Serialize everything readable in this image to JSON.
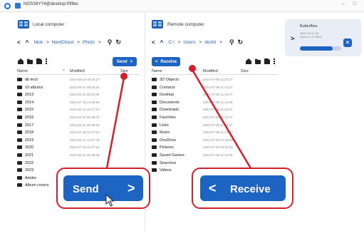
{
  "window": {
    "title": "NGSS8YY4@desktop-f0f8ec",
    "controls": "– □"
  },
  "local": {
    "title": "Local computer",
    "breadcrumb": [
      "Nick",
      "NextCloud",
      "Photo"
    ],
    "send_label": "Send",
    "columns": {
      "name": "Name",
      "modified": "Modified",
      "size": "Size"
    },
    "files": [
      {
        "name": "db tech",
        "date": "2024-05-10 09:26:27"
      },
      {
        "name": "10 albums",
        "date": "2024-05-11 09:25:40"
      },
      {
        "name": "2013",
        "date": "2024-05-11 09:22:36"
      },
      {
        "name": "2014",
        "date": "2024-07-16 14:59:58"
      },
      {
        "name": "2015",
        "date": "2024-05-11 10:27:10"
      },
      {
        "name": "2016",
        "date": "2024-05-11 09:38:03"
      },
      {
        "name": "2017",
        "date": "2024-05-11 09:38:25"
      },
      {
        "name": "2018",
        "date": "2024-07-16 14:47:22"
      },
      {
        "name": "2019",
        "date": "2024-05-11 12:07:44"
      },
      {
        "name": "2020",
        "date": "2024-07-16 14:57:22"
      },
      {
        "name": "2021",
        "date": "2024-05-11 09:39:48"
      },
      {
        "name": "2022",
        "date": ""
      },
      {
        "name": "2023",
        "date": ""
      },
      {
        "name": "Adobe",
        "date": ""
      },
      {
        "name": "Album covers",
        "date": ""
      }
    ]
  },
  "remote": {
    "title": "Remote computer",
    "breadcrumb": [
      "C:\\",
      "Users",
      "donhi"
    ],
    "receive_label": "Receive",
    "columns": {
      "name": "Name",
      "modified": "Modified",
      "size": "Size"
    },
    "files": [
      {
        "name": "3D Objects",
        "date": "2024-07-08 11:13:27"
      },
      {
        "name": "Contacts",
        "date": "2024-07-08 11:13:27"
      },
      {
        "name": "Desktop",
        "date": "2024-07-08 11:13:27"
      },
      {
        "name": "Documents",
        "date": "2024-07-08 11:13:08"
      },
      {
        "name": "Downloads",
        "date": "2024-07-08 11:13:27"
      },
      {
        "name": "Favorites",
        "date": "2024-07-08 11:13:27"
      },
      {
        "name": "Links",
        "date": "2024-07-08 11:13:27"
      },
      {
        "name": "Music",
        "date": "2024-07-08 11:13:27"
      },
      {
        "name": "OneDrive",
        "date": "2024-07-25 07:03:09"
      },
      {
        "name": "Pictures",
        "date": "2024-07-25 08:03:04"
      },
      {
        "name": "Saved Games",
        "date": "2024-07-08 11:13:08"
      },
      {
        "name": "Searches",
        "date": ""
      },
      {
        "name": "Videos",
        "date": ""
      }
    ]
  },
  "transfer": {
    "title": "Butterflies",
    "detail_1": "Total 16.16 GB",
    "detail_2": "Speed 1.00 MB/s",
    "progress_fraction": 0.8
  },
  "callouts": {
    "send_label": "Send",
    "receive_label": "Receive"
  },
  "colors": {
    "accent": "#1d64c2",
    "highlight": "#d0202c"
  }
}
